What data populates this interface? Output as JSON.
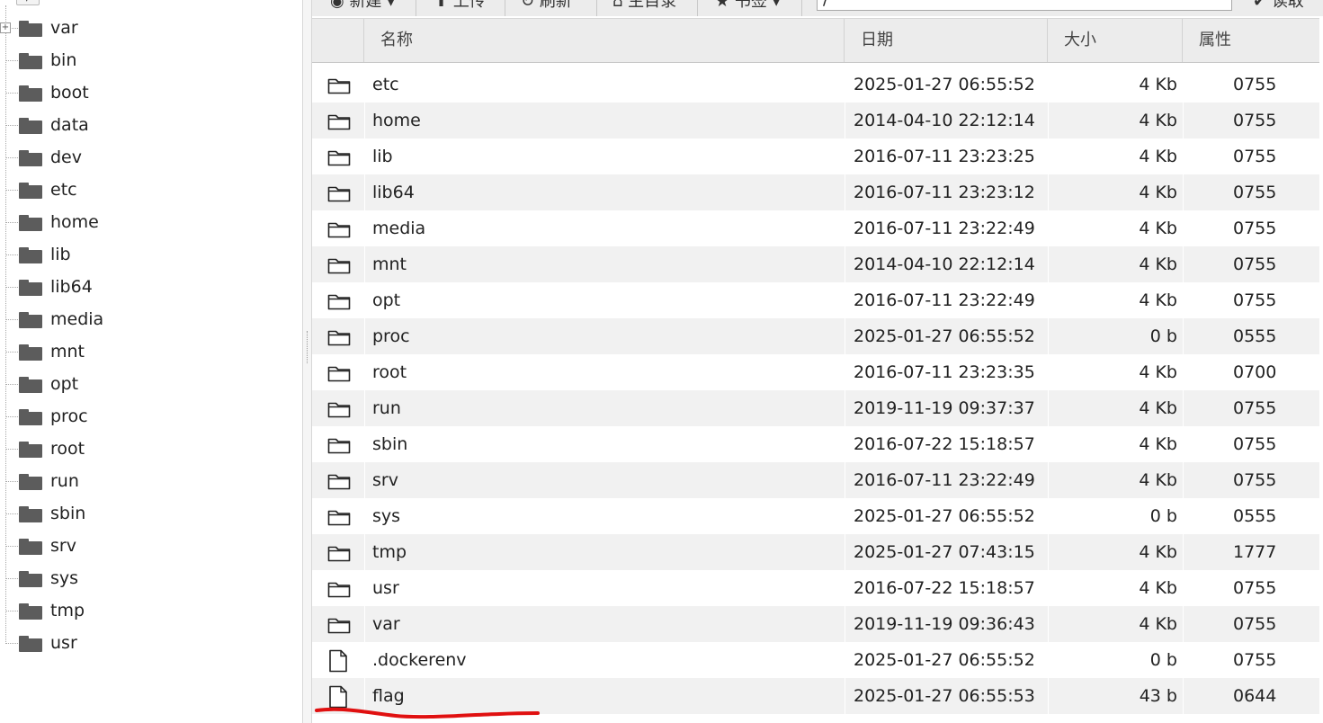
{
  "toolbar": {
    "btn_new": "新建",
    "btn_upload": "上传",
    "btn_refresh": "刷新",
    "btn_home": "主目录",
    "btn_bookmark": "书签",
    "path_value": "/",
    "btn_read": "读取"
  },
  "tree": {
    "root_label": "/",
    "items": [
      {
        "label": "var"
      },
      {
        "label": "bin"
      },
      {
        "label": "boot"
      },
      {
        "label": "data"
      },
      {
        "label": "dev"
      },
      {
        "label": "etc"
      },
      {
        "label": "home"
      },
      {
        "label": "lib"
      },
      {
        "label": "lib64"
      },
      {
        "label": "media"
      },
      {
        "label": "mnt"
      },
      {
        "label": "opt"
      },
      {
        "label": "proc"
      },
      {
        "label": "root"
      },
      {
        "label": "run"
      },
      {
        "label": "sbin"
      },
      {
        "label": "srv"
      },
      {
        "label": "sys"
      },
      {
        "label": "tmp"
      },
      {
        "label": "usr"
      }
    ]
  },
  "grid": {
    "columns": {
      "name": "名称",
      "date": "日期",
      "size": "大小",
      "attr": "属性"
    },
    "rows": [
      {
        "type": "folder",
        "name": "etc",
        "date": "2025-01-27 06:55:52",
        "size": "4 Kb",
        "attr": "0755"
      },
      {
        "type": "folder",
        "name": "home",
        "date": "2014-04-10 22:12:14",
        "size": "4 Kb",
        "attr": "0755"
      },
      {
        "type": "folder",
        "name": "lib",
        "date": "2016-07-11 23:23:25",
        "size": "4 Kb",
        "attr": "0755"
      },
      {
        "type": "folder",
        "name": "lib64",
        "date": "2016-07-11 23:23:12",
        "size": "4 Kb",
        "attr": "0755"
      },
      {
        "type": "folder",
        "name": "media",
        "date": "2016-07-11 23:22:49",
        "size": "4 Kb",
        "attr": "0755"
      },
      {
        "type": "folder",
        "name": "mnt",
        "date": "2014-04-10 22:12:14",
        "size": "4 Kb",
        "attr": "0755"
      },
      {
        "type": "folder",
        "name": "opt",
        "date": "2016-07-11 23:22:49",
        "size": "4 Kb",
        "attr": "0755"
      },
      {
        "type": "folder",
        "name": "proc",
        "date": "2025-01-27 06:55:52",
        "size": "0 b",
        "attr": "0555"
      },
      {
        "type": "folder",
        "name": "root",
        "date": "2016-07-11 23:23:35",
        "size": "4 Kb",
        "attr": "0700"
      },
      {
        "type": "folder",
        "name": "run",
        "date": "2019-11-19 09:37:37",
        "size": "4 Kb",
        "attr": "0755"
      },
      {
        "type": "folder",
        "name": "sbin",
        "date": "2016-07-22 15:18:57",
        "size": "4 Kb",
        "attr": "0755"
      },
      {
        "type": "folder",
        "name": "srv",
        "date": "2016-07-11 23:22:49",
        "size": "4 Kb",
        "attr": "0755"
      },
      {
        "type": "folder",
        "name": "sys",
        "date": "2025-01-27 06:55:52",
        "size": "0 b",
        "attr": "0555"
      },
      {
        "type": "folder",
        "name": "tmp",
        "date": "2025-01-27 07:43:15",
        "size": "4 Kb",
        "attr": "1777"
      },
      {
        "type": "folder",
        "name": "usr",
        "date": "2016-07-22 15:18:57",
        "size": "4 Kb",
        "attr": "0755"
      },
      {
        "type": "folder",
        "name": "var",
        "date": "2019-11-19 09:36:43",
        "size": "4 Kb",
        "attr": "0755"
      },
      {
        "type": "file",
        "name": ".dockerenv",
        "date": "2025-01-27 06:55:52",
        "size": "0 b",
        "attr": "0755"
      },
      {
        "type": "file",
        "name": "flag",
        "date": "2025-01-27 06:55:53",
        "size": "43 b",
        "attr": "0644"
      }
    ]
  },
  "annotation": {
    "color": "#e01010"
  }
}
